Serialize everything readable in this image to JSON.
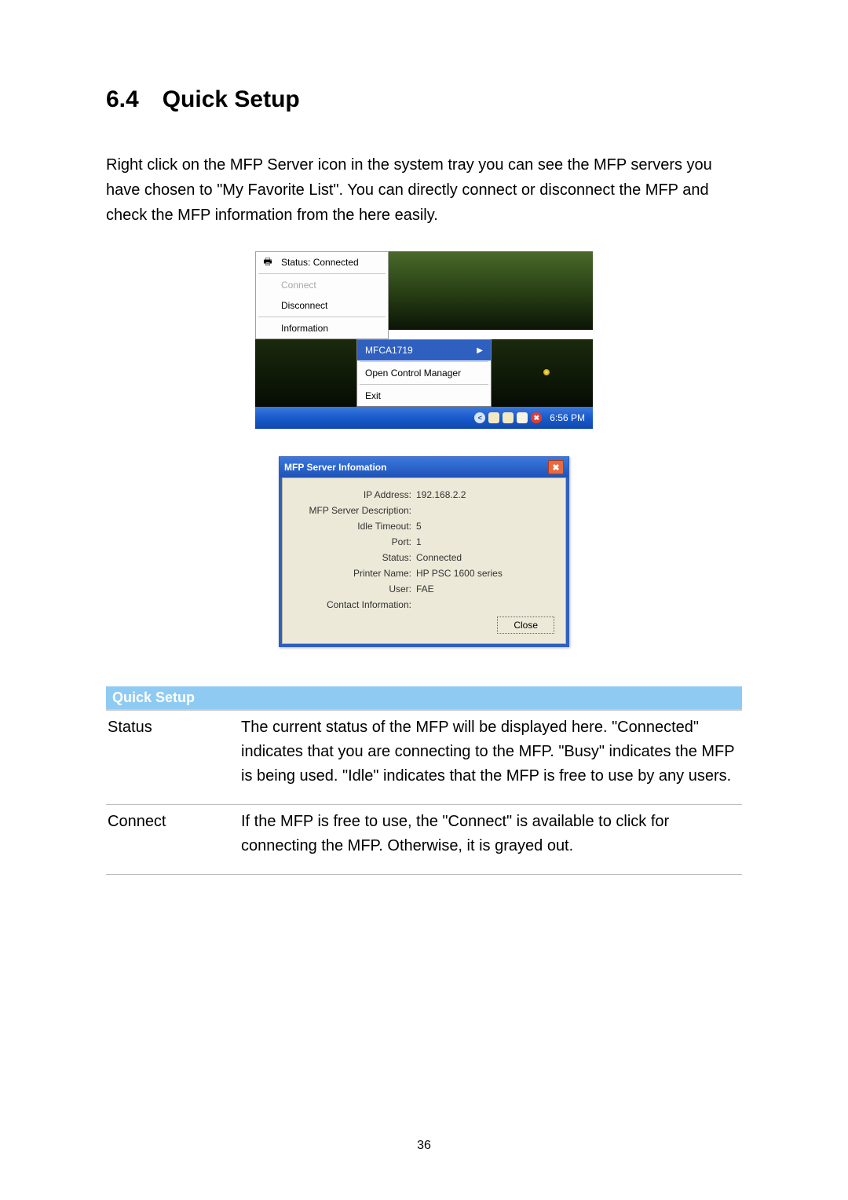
{
  "section": {
    "number": "6.4",
    "title": "Quick Setup"
  },
  "intro": "Right click on the MFP Server icon in the system tray you can see the MFP servers you have chosen to \"My Favorite List\". You can directly connect or disconnect the MFP and check the MFP information from the here easily.",
  "menu": {
    "status": "Status: Connected",
    "connect": "Connect",
    "disconnect": "Disconnect",
    "information": "Information"
  },
  "submenu": {
    "highlighted": "MFCA1719",
    "open_manager": "Open Control Manager",
    "exit": "Exit"
  },
  "taskbar": {
    "time": "6:56 PM"
  },
  "dialog": {
    "title": "MFP Server Infomation",
    "rows": {
      "ip_label": "IP Address:",
      "ip_value": "192.168.2.2",
      "desc_label": "MFP Server Description:",
      "desc_value": "",
      "idle_label": "Idle Timeout:",
      "idle_value": "5",
      "port_label": "Port:",
      "port_value": "1",
      "status_label": "Status:",
      "status_value": "Connected",
      "printer_label": "Printer Name:",
      "printer_value": "HP PSC 1600 series",
      "user_label": "User:",
      "user_value": "FAE",
      "contact_label": "Contact Information:",
      "contact_value": ""
    },
    "close": "Close"
  },
  "table": {
    "header": "Quick Setup",
    "rows": [
      {
        "term": "Status",
        "desc": "The current status of the MFP will be displayed here. \"Connected\" indicates that you are connecting to the MFP. \"Busy\" indicates the MFP is being used. \"Idle\" indicates that the MFP is free to use by any users."
      },
      {
        "term": "Connect",
        "desc": "If the MFP is free to use, the \"Connect\" is available to click for connecting the MFP. Otherwise, it is grayed out."
      }
    ]
  },
  "page_number": "36"
}
